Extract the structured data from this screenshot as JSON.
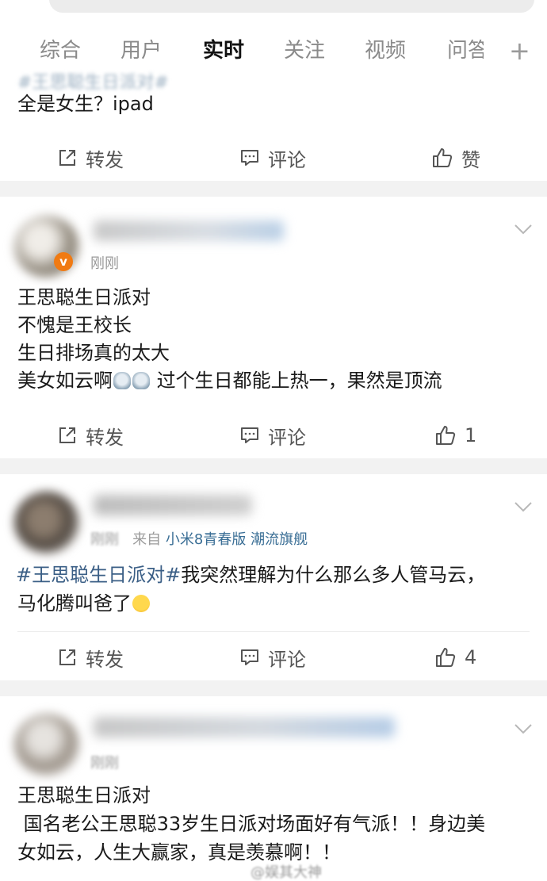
{
  "tabs": {
    "items": [
      {
        "label": "综合"
      },
      {
        "label": "用户"
      },
      {
        "label": "实时"
      },
      {
        "label": "关注"
      },
      {
        "label": "视频"
      },
      {
        "label": "问答"
      }
    ],
    "active_index": 2,
    "plus": "+"
  },
  "post0": {
    "hashtag_line": "#王思聪生日派对#",
    "text": "全是女生？ipad",
    "actions": {
      "repost": "转发",
      "comment": "评论",
      "like": "赞"
    }
  },
  "post1": {
    "time": "刚刚",
    "lines": [
      "王思聪生日派对",
      "不愧是王校长",
      "生日排场真的太大"
    ],
    "line4_before": "美女如云啊",
    "line4_after": " 过个生日都能上热一，果然是顶流",
    "actions": {
      "repost": "转发",
      "comment": "评论",
      "like": "1"
    }
  },
  "post2": {
    "time": "刚刚",
    "from": "来自",
    "source": "小米8青春版 潮流旗舰",
    "hashtag": "#王思聪生日派对#",
    "text_after_tag": "我突然理解为什么那么多人管马云，",
    "line2": "马化腾叫爸了",
    "actions": {
      "repost": "转发",
      "comment": "评论",
      "like": "4"
    }
  },
  "post3": {
    "time": "刚刚",
    "line1": "王思聪生日派对",
    "line2": " 国名老公王思聪33岁生日派对场面好有气派！！身边美",
    "line3": "女如云，人生大赢家，真是羡慕啊！！"
  },
  "watermark": "@娱其大神",
  "colors": {
    "accent": "#f28d1b",
    "link": "#3b5f86",
    "vip": "#f07a12"
  }
}
